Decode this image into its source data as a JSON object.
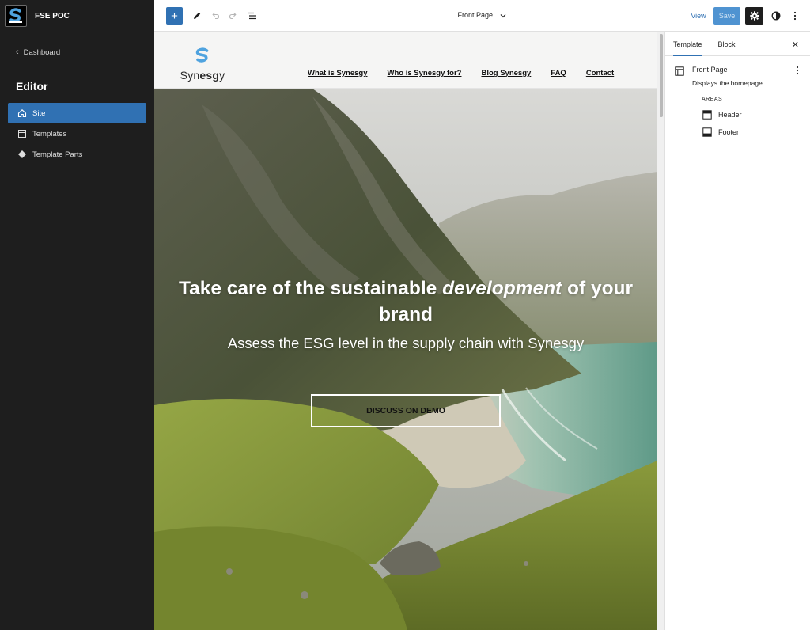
{
  "site": {
    "title": "FSE POC"
  },
  "sidebar": {
    "back_label": "Dashboard",
    "heading": "Editor",
    "items": [
      {
        "label": "Site",
        "icon": "home-icon",
        "active": true
      },
      {
        "label": "Templates",
        "icon": "layout-icon",
        "active": false
      },
      {
        "label": "Template Parts",
        "icon": "symbol-filled-icon",
        "active": false
      }
    ]
  },
  "toolbar": {
    "document_title": "Front Page",
    "view_label": "View",
    "save_label": "Save",
    "icons": [
      "plus-icon",
      "edit-icon",
      "undo-icon",
      "redo-icon",
      "list-view-icon",
      "chevron-down-icon",
      "cog-icon",
      "contrast-icon",
      "more-vertical-icon"
    ]
  },
  "canvas": {
    "logo": {
      "prefix": "Syn",
      "bold": "esg",
      "suffix": "y"
    },
    "nav": [
      "What is Synesgy",
      "Who is Synesgy for?",
      "Blog Synesgy",
      "FAQ",
      "Contact"
    ],
    "hero": {
      "title_before": "Take care of the sustainable ",
      "title_em": "development",
      "title_after": " of your brand",
      "subtitle": "Assess the ESG level in the supply chain with Synesgy",
      "button_label": "DISCUSS ON DEMO"
    }
  },
  "inspector": {
    "tabs": [
      {
        "label": "Template",
        "active": true
      },
      {
        "label": "Block",
        "active": false
      }
    ],
    "template": {
      "name": "Front Page",
      "description": "Displays the homepage.",
      "areas_label": "AREAS",
      "areas": [
        {
          "label": "Header",
          "icon": "header-icon"
        },
        {
          "label": "Footer",
          "icon": "footer-icon"
        }
      ]
    }
  },
  "colors": {
    "accent": "#3071b3",
    "sidebar_bg": "#1e1e1e",
    "save_disabled": "#4f93d1"
  }
}
